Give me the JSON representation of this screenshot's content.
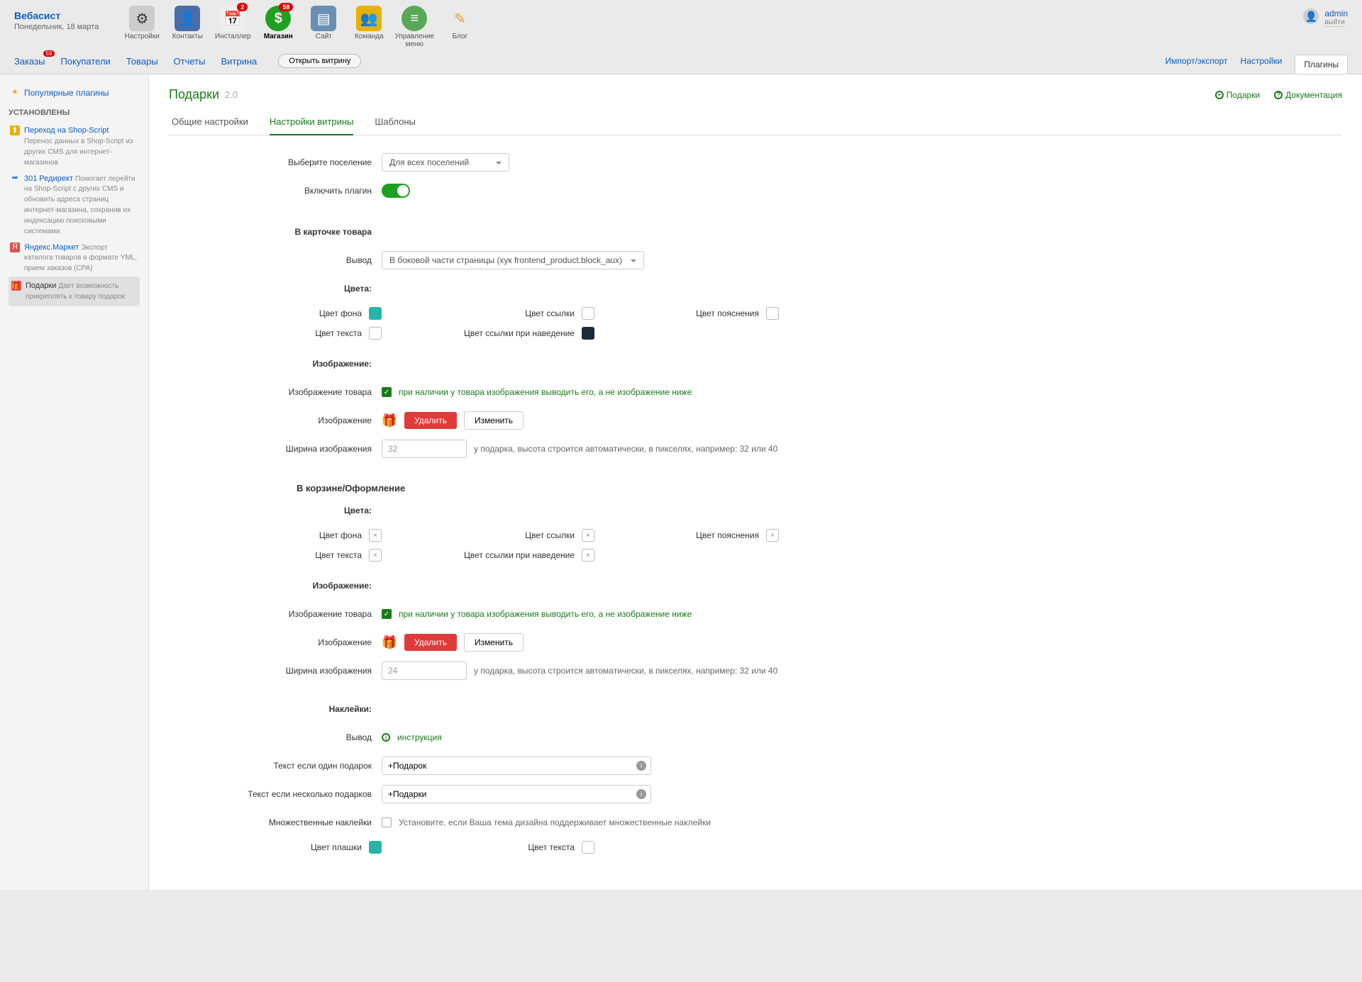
{
  "brand": {
    "name": "Вебасист",
    "date": "Понедельник, 18 марта"
  },
  "apps": [
    {
      "label": "Настройки",
      "bg": "#888"
    },
    {
      "label": "Контакты",
      "bg": "#4a6da7"
    },
    {
      "label": "Инсталлер",
      "bg": "#ddd",
      "badge": "2"
    },
    {
      "label": "Магазин",
      "bg": "#20a020",
      "badge": "58",
      "active": true
    },
    {
      "label": "Сайт",
      "bg": "#6a8fb5"
    },
    {
      "label": "Команда",
      "bg": "#e8b000"
    },
    {
      "label": "Управление меню",
      "bg": "#58a858"
    },
    {
      "label": "Блог",
      "bg": "#e8a030"
    }
  ],
  "user": {
    "name": "admin",
    "logout": "выйти"
  },
  "subnav": {
    "items": [
      "Заказы",
      "Покупатели",
      "Товары",
      "Отчеты",
      "Витрина"
    ],
    "orders_badge": "59",
    "open_store": "Открыть витрину",
    "right": [
      "Импорт/экспорт",
      "Настройки",
      "Плагины"
    ]
  },
  "sidebar": {
    "popular": "Популярные плагины",
    "installed": "УСТАНОВЛЕНЫ",
    "items": [
      {
        "title": "Переход на Shop-Script",
        "desc": "Перенос данных в Shop-Script из других CMS для интернет-магазинов"
      },
      {
        "title": "301 Редирект",
        "desc": "Помогает перейти на Shop-Script с других CMS и обновить адреса страниц интернет-магазина, сохранив их индексацию поисковыми системами."
      },
      {
        "title": "Яндекс.Маркет",
        "desc": "Экспорт каталога товаров в формате YML, прием заказов (CPA)"
      },
      {
        "title": "Подарки",
        "desc": "Дает возможность прикреплять к товару подарок",
        "selected": true
      }
    ]
  },
  "page": {
    "title": "Подарки",
    "version": "2.0",
    "link_gifts": "Подарки",
    "link_docs": "Документация",
    "tabs": [
      "Общие настройки",
      "Настройки витрины",
      "Шаблоны"
    ],
    "choose_settlement": "Выберите поселение",
    "settlement_value": "Для всех поселений",
    "enable_plugin": "Включить плагин",
    "card_h": "В карточке товара",
    "output": "Вывод",
    "output_value": "В боковой части страницы (хук frontend_product.block_aux)",
    "colors_h": "Цвета:",
    "c_bg": "Цвет фона",
    "c_link": "Цвет ссылки",
    "c_expl": "Цвет пояснения",
    "c_text": "Цвет текста",
    "c_link_hover": "Цвет ссылки при наведение",
    "image_h": "Изображение:",
    "img_product": "Изображение товара",
    "img_product_hint": "при наличии у товара изображения выводить его, а не изображение ниже",
    "img_label": "Изображение",
    "btn_delete": "Удалить",
    "btn_change": "Изменить",
    "img_width": "Ширина изображения",
    "img_width_val_card": "32",
    "img_width_hint": "у подарка, высота строится автоматически, в пикселях, например: 32 или 40",
    "cart_h": "В корзине/Оформление",
    "img_width_val_cart": "24",
    "stickers_h": "Наклейки:",
    "instruction": "инструкция",
    "one_gift": "Текст если один подарок",
    "one_gift_val": "+Подарок",
    "many_gifts": "Текст если несколько подарков",
    "many_gifts_val": "+Подарки",
    "multi_stickers": "Множественные наклейки",
    "multi_hint": "Установите, если Ваша тема дизайна поддерживает множественные наклейки",
    "badge_color": "Цвет плашки",
    "text_color": "Цвет текста"
  }
}
